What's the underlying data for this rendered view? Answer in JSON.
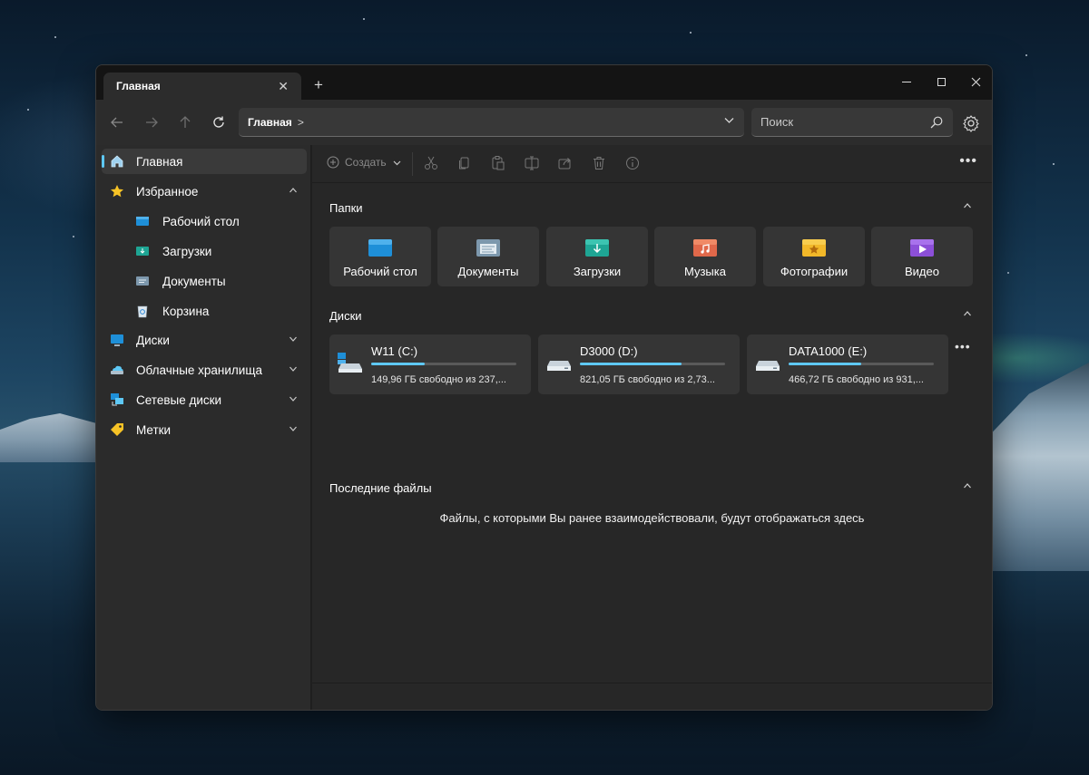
{
  "window": {
    "tab_title": "Главная",
    "close_tab_glyph": "✕",
    "new_tab_glyph": "+"
  },
  "navbar": {
    "breadcrumb": "Главная",
    "breadcrumb_sep": ">",
    "search_placeholder": "Поиск"
  },
  "sidebar": {
    "home": "Главная",
    "favorites": "Избранное",
    "desktop": "Рабочий стол",
    "downloads": "Загрузки",
    "documents": "Документы",
    "recycle": "Корзина",
    "drives": "Диски",
    "cloud": "Облачные хранилища",
    "network": "Сетевые диски",
    "tags": "Метки"
  },
  "toolbar": {
    "create_label": "Создать"
  },
  "folders_section": {
    "title": "Папки",
    "items": [
      "Рабочий стол",
      "Документы",
      "Загрузки",
      "Музыка",
      "Фотографии",
      "Видео"
    ]
  },
  "drives_section": {
    "title": "Диски",
    "items": [
      {
        "name": "W11 (C:)",
        "free": "149,96 ГБ свободно из 237,...",
        "used_fraction": 0.37
      },
      {
        "name": "D3000 (D:)",
        "free": "821,05 ГБ свободно из 2,73...",
        "used_fraction": 0.7
      },
      {
        "name": "DATA1000 (E:)",
        "free": "466,72 ГБ свободно из 931,...",
        "used_fraction": 0.5
      }
    ]
  },
  "recent_section": {
    "title": "Последние файлы",
    "empty_message": "Файлы, с которыми Вы ранее взаимодействовали, будут отображаться здесь"
  },
  "colors": {
    "accent": "#5ec8f5",
    "window_bg": "#202020",
    "sidebar_bg": "#2b2b2b",
    "content_bg": "#272727",
    "card_bg": "#353535"
  }
}
